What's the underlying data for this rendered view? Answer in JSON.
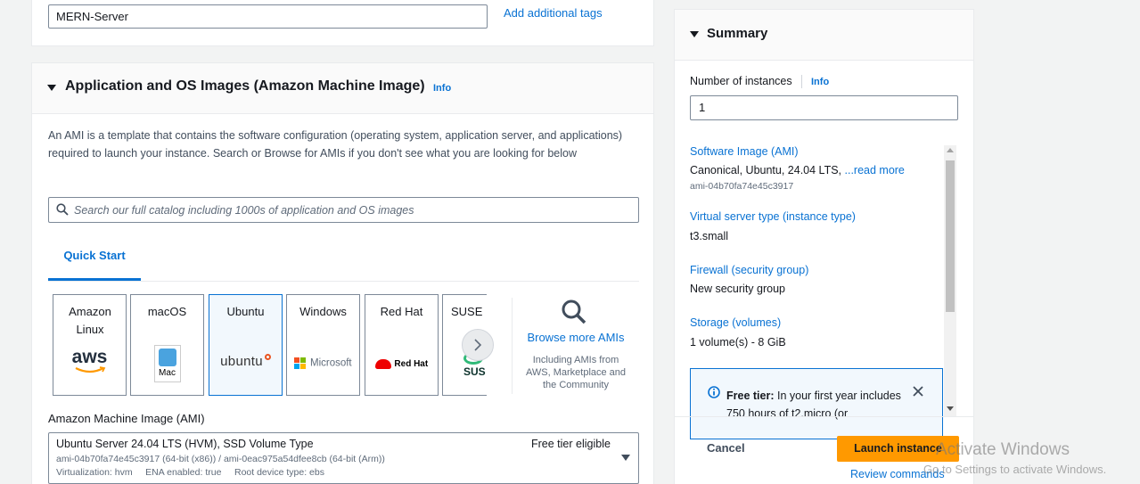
{
  "name_tags": {
    "name_value": "MERN-Server",
    "add_tags_label": "Add additional tags"
  },
  "ami_section": {
    "title": "Application and OS Images (Amazon Machine Image)",
    "info": "Info",
    "description": "An AMI is a template that contains the software configuration (operating system, application server, and applications) required to launch your instance. Search or Browse for AMIs if you don't see what you are looking for below",
    "search_placeholder": "Search our full catalog including 1000s of application and OS images",
    "tabs": [
      {
        "label": "Quick Start"
      }
    ],
    "os_options": [
      {
        "name": "Amazon Linux",
        "logo_text": "aws"
      },
      {
        "name": "macOS",
        "logo_text": "Mac"
      },
      {
        "name": "Ubuntu",
        "logo_text": "ubuntu",
        "selected": true
      },
      {
        "name": "Windows",
        "logo_text": "Microsoft"
      },
      {
        "name": "Red Hat",
        "logo_text": "Red Hat"
      },
      {
        "name": "SUSE L",
        "logo_text": "SUS"
      }
    ],
    "browse": {
      "link": "Browse more AMIs",
      "subtext": "Including AMIs from AWS, Marketplace and the Community"
    },
    "ami_label": "Amazon Machine Image (AMI)",
    "selected_ami": {
      "name": "Ubuntu Server 24.04 LTS (HVM), SSD Volume Type",
      "badge": "Free tier eligible",
      "ids": "ami-04b70fa74e45c3917 (64-bit (x86)) / ami-0eac975a54dfee8cb (64-bit (Arm))",
      "meta": "Virtualization: hvm     ENA enabled: true     Root device type: ebs"
    }
  },
  "summary": {
    "title": "Summary",
    "instances_label": "Number of instances",
    "instances_info": "Info",
    "instances_value": "1",
    "software_image_label": "Software Image (AMI)",
    "software_image_value": "Canonical, Ubuntu, 24.04 LTS, ",
    "software_image_more": "...read more",
    "software_image_id": "ami-04b70fa74e45c3917",
    "instance_type_label": "Virtual server type (instance type)",
    "instance_type_value": "t3.small",
    "firewall_label": "Firewall (security group)",
    "firewall_value": "New security group",
    "storage_label": "Storage (volumes)",
    "storage_value": "1 volume(s) - 8 GiB",
    "free_tier_title": "Free tier:",
    "free_tier_text": " In your first year includes 750 hours of t2.micro (or",
    "cancel_label": "Cancel",
    "launch_label": "Launch instance",
    "review_label": "Review commands"
  },
  "watermark": {
    "title": "Activate Windows",
    "subtitle": "Go to Settings to activate Windows."
  },
  "colors": {
    "link": "#0972d3",
    "primary_button": "#ff9900",
    "selected_card_bg": "#f2f8fd"
  }
}
